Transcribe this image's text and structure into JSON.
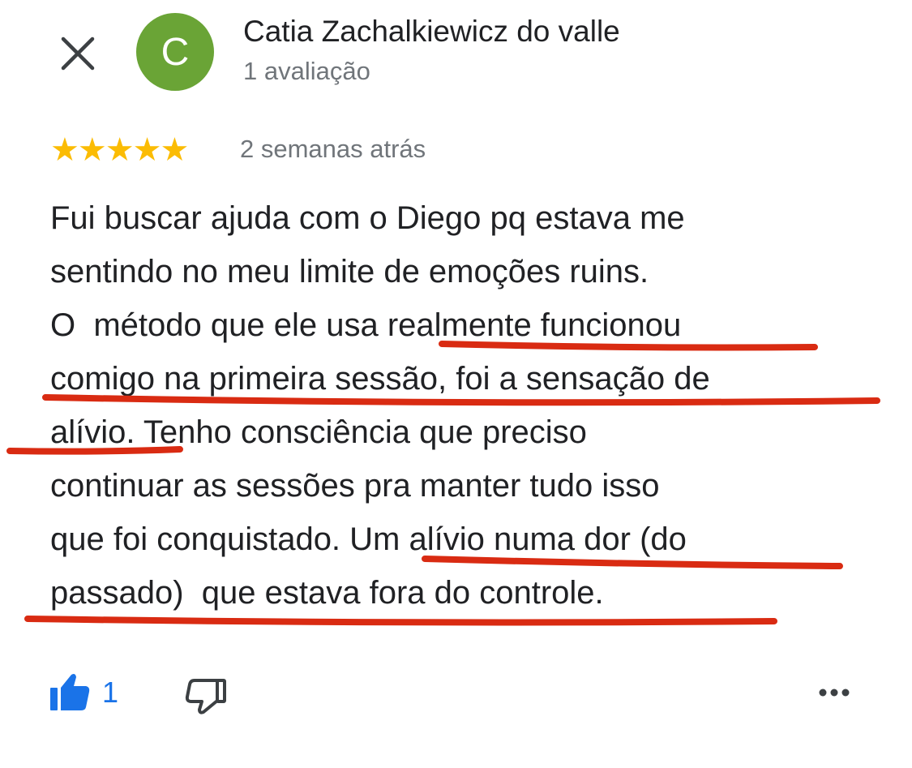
{
  "header": {
    "close_icon": "close-icon",
    "avatar_letter": "C",
    "avatar_color": "#6aa436",
    "reviewer_name": "Catia Zachalkiewicz do valle",
    "review_count": "1 avaliação"
  },
  "review": {
    "rating": 5,
    "rating_max": 5,
    "stars": "★★★★★",
    "time_ago": "2 semanas atrás",
    "lines": [
      "Fui buscar ajuda com o Diego pq estava me",
      "sentindo no meu limite de emoções ruins.",
      "O  método que ele usa realmente funcionou",
      "comigo na primeira sessão, foi a sensação de",
      "alívio. Tenho consciência que preciso",
      "continuar as sessões pra manter tudo isso",
      "que foi conquistado. Um alívio numa dor (do",
      "passado)  que estava fora do controle."
    ],
    "underline_color": "#d92b12"
  },
  "actions": {
    "like_icon": "thumbs-up-icon",
    "like_count": "1",
    "like_color": "#1a73e8",
    "dislike_icon": "thumbs-down-icon",
    "more_icon": "more-horizontal-icon"
  }
}
